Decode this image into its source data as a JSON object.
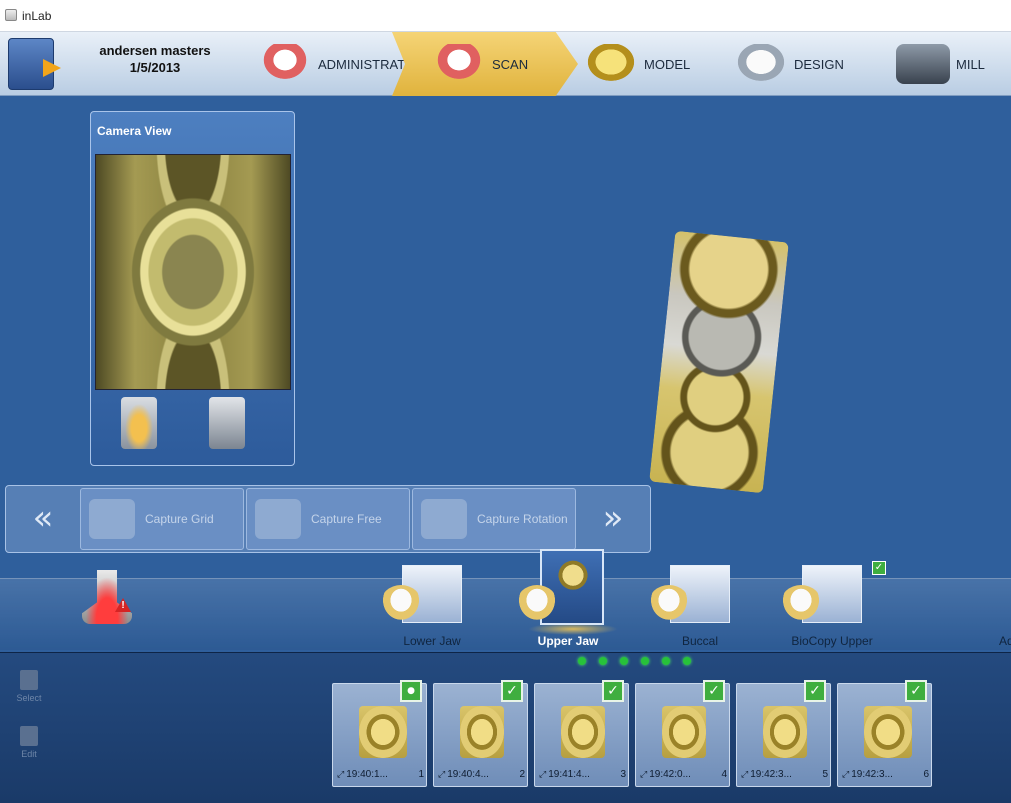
{
  "window": {
    "title": "inLab"
  },
  "case": {
    "name": "andersen masters",
    "date": "1/5/2013"
  },
  "workflow": [
    {
      "label": "ADMINISTRATION",
      "icon": "dental-arch-icon"
    },
    {
      "label": "SCAN",
      "icon": "scanner-jaw-icon",
      "active": true
    },
    {
      "label": "MODEL",
      "icon": "gold-model-icon"
    },
    {
      "label": "DESIGN",
      "icon": "silver-crown-icon"
    },
    {
      "label": "MILL",
      "icon": "milling-unit-icon"
    }
  ],
  "camera_view": {
    "title": "Camera View"
  },
  "capture_modes": [
    {
      "label": "Capture Grid"
    },
    {
      "label": "Capture Free"
    },
    {
      "label": "Capture Rotation"
    }
  ],
  "catalog": [
    {
      "label": "Lower Jaw"
    },
    {
      "label": "Upper Jaw",
      "selected": true
    },
    {
      "label": "Buccal"
    },
    {
      "label": "BioCopy Upper"
    }
  ],
  "catalog_overflow_label": "Ad",
  "side_tools": {
    "select": "Select",
    "edit": "Edit"
  },
  "scans": [
    {
      "time": "19:40:1...",
      "index": "1"
    },
    {
      "time": "19:40:4...",
      "index": "2"
    },
    {
      "time": "19:41:4...",
      "index": "3"
    },
    {
      "time": "19:42:0...",
      "index": "4"
    },
    {
      "time": "19:42:3...",
      "index": "5"
    },
    {
      "time": "19:42:3...",
      "index": "6"
    }
  ],
  "colors": {
    "accent": "#e0b33d",
    "background": "#2f5f9c",
    "check": "#3fae3f"
  }
}
